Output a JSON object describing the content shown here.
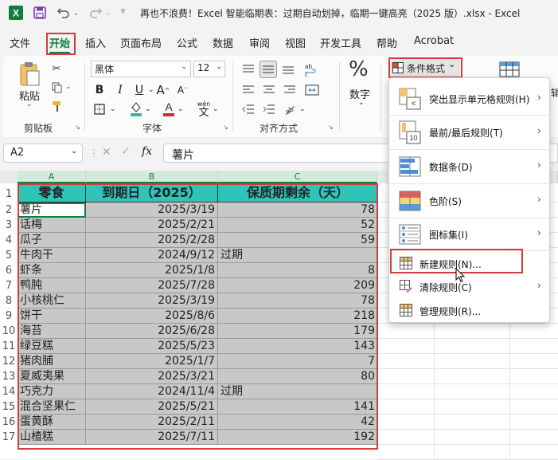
{
  "titlebar": {
    "title": "再也不浪费！Excel 智能临期表：过期自动划掉，临期一键高亮（2025 版）.xlsx  -  Excel",
    "icons": [
      "excel-logo",
      "save-icon",
      "undo-icon",
      "redo-icon",
      "customize-icon"
    ]
  },
  "tabs": [
    "文件",
    "开始",
    "插入",
    "页面布局",
    "公式",
    "数据",
    "审阅",
    "视图",
    "开发工具",
    "帮助",
    "Acrobat"
  ],
  "active_tab": "开始",
  "ribbon": {
    "clipboard": {
      "paste_label": "粘贴",
      "group_label": "剪贴板"
    },
    "font": {
      "font_name": "黑体",
      "font_size": "12",
      "group_label": "字体",
      "wen_label": "wén",
      "wen_char": "文"
    },
    "alignment": {
      "group_label": "对齐方式"
    },
    "number": {
      "label": "数字",
      "percent": "%"
    },
    "conditional_format": {
      "label": "条件格式",
      "arrow": "⌄"
    }
  },
  "formula_bar": {
    "cell_ref": "A2",
    "fx": "fx",
    "value": "薯片"
  },
  "grid": {
    "columns": [
      "A",
      "B",
      "C"
    ],
    "header": [
      "零食",
      "到期日（2025）",
      "保质期剩余（天）"
    ],
    "rows": [
      [
        "薯片",
        "2025/3/19",
        "78"
      ],
      [
        "话梅",
        "2025/2/21",
        "52"
      ],
      [
        "瓜子",
        "2025/2/28",
        "59"
      ],
      [
        "牛肉干",
        "2024/9/12",
        "过期"
      ],
      [
        "虾条",
        "2025/1/8",
        "8"
      ],
      [
        "鸭肫",
        "2025/7/28",
        "209"
      ],
      [
        "小核桃仁",
        "2025/3/19",
        "78"
      ],
      [
        "饼干",
        "2025/8/6",
        "218"
      ],
      [
        "海苔",
        "2025/6/28",
        "179"
      ],
      [
        "绿豆糕",
        "2025/5/23",
        "143"
      ],
      [
        "猪肉脯",
        "2025/1/7",
        "7"
      ],
      [
        "夏威夷果",
        "2025/3/21",
        "80"
      ],
      [
        "巧克力",
        "2024/11/4",
        "过期"
      ],
      [
        "混合坚果仁",
        "2025/5/21",
        "141"
      ],
      [
        "蛋黄酥",
        "2025/2/11",
        "42"
      ],
      [
        "山楂糕",
        "2025/7/11",
        "192"
      ]
    ],
    "row_numbers": [
      "1",
      "2",
      "3",
      "4",
      "5",
      "6",
      "7",
      "8",
      "9",
      "10",
      "11",
      "12",
      "13",
      "14",
      "15",
      "16",
      "17"
    ]
  },
  "menu": {
    "items": [
      {
        "label": "突出显示单元格规则(H)",
        "submenu": true,
        "icon": "highlight-rules-icon"
      },
      {
        "label": "最前/最后规则(T)",
        "submenu": true,
        "icon": "top-bottom-rules-icon"
      },
      {
        "label": "数据条(D)",
        "submenu": true,
        "icon": "data-bars-icon"
      },
      {
        "label": "色阶(S)",
        "submenu": true,
        "icon": "color-scales-icon"
      },
      {
        "label": "图标集(I)",
        "submenu": true,
        "icon": "icon-sets-icon"
      },
      {
        "label": "新建规则(N)...",
        "submenu": false,
        "icon": "new-rule-icon",
        "highlighted": true
      },
      {
        "label": "清除规则(C)",
        "submenu": true,
        "icon": "clear-rules-icon"
      },
      {
        "label": "管理规则(R)...",
        "submenu": false,
        "icon": "manage-rules-icon"
      }
    ],
    "icon_texts": {
      "highlight": "<",
      "top": "10"
    }
  },
  "colors": {
    "accent": "#107c41",
    "header_teal": "#2ec4b6",
    "highlight_red": "#d63b3b",
    "gray_fill": "#c8c8c8"
  }
}
